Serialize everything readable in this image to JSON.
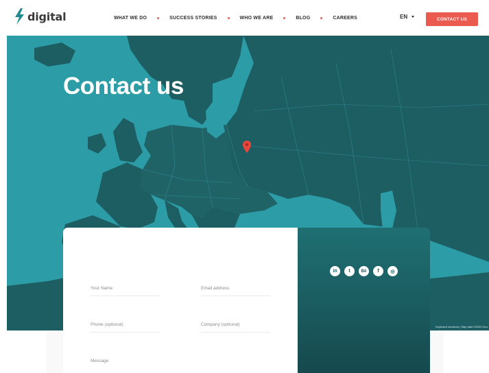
{
  "brand": {
    "name": "digital",
    "colors": {
      "accent": "#eb5a4e",
      "sea": "#2c9da7",
      "land": "#1d5e63",
      "panel": "#1a5b5f"
    }
  },
  "nav": {
    "items": [
      {
        "label": "WHAT WE DO"
      },
      {
        "label": "SUCCESS STORIES"
      },
      {
        "label": "WHO WE ARE"
      },
      {
        "label": "BLOG"
      },
      {
        "label": "CAREERS"
      }
    ],
    "language": "EN",
    "cta_label": "CONTACT US"
  },
  "hero": {
    "title": "Contact us",
    "map_attribution": "Keyboard shortcuts | Map data ©2023 Goo"
  },
  "form": {
    "name_label": "Your Name",
    "email_label": "Email address",
    "phone_label": "Phone (optional)",
    "company_label": "Company (optional)",
    "message_label": "Message"
  },
  "social": {
    "icons": [
      {
        "name": "linkedin-icon",
        "glyph": "in"
      },
      {
        "name": "twitter-icon",
        "glyph": "t"
      },
      {
        "name": "behance-icon",
        "glyph": "Bē"
      },
      {
        "name": "facebook-icon",
        "glyph": "f"
      },
      {
        "name": "instagram-icon",
        "glyph": "◎"
      }
    ]
  }
}
